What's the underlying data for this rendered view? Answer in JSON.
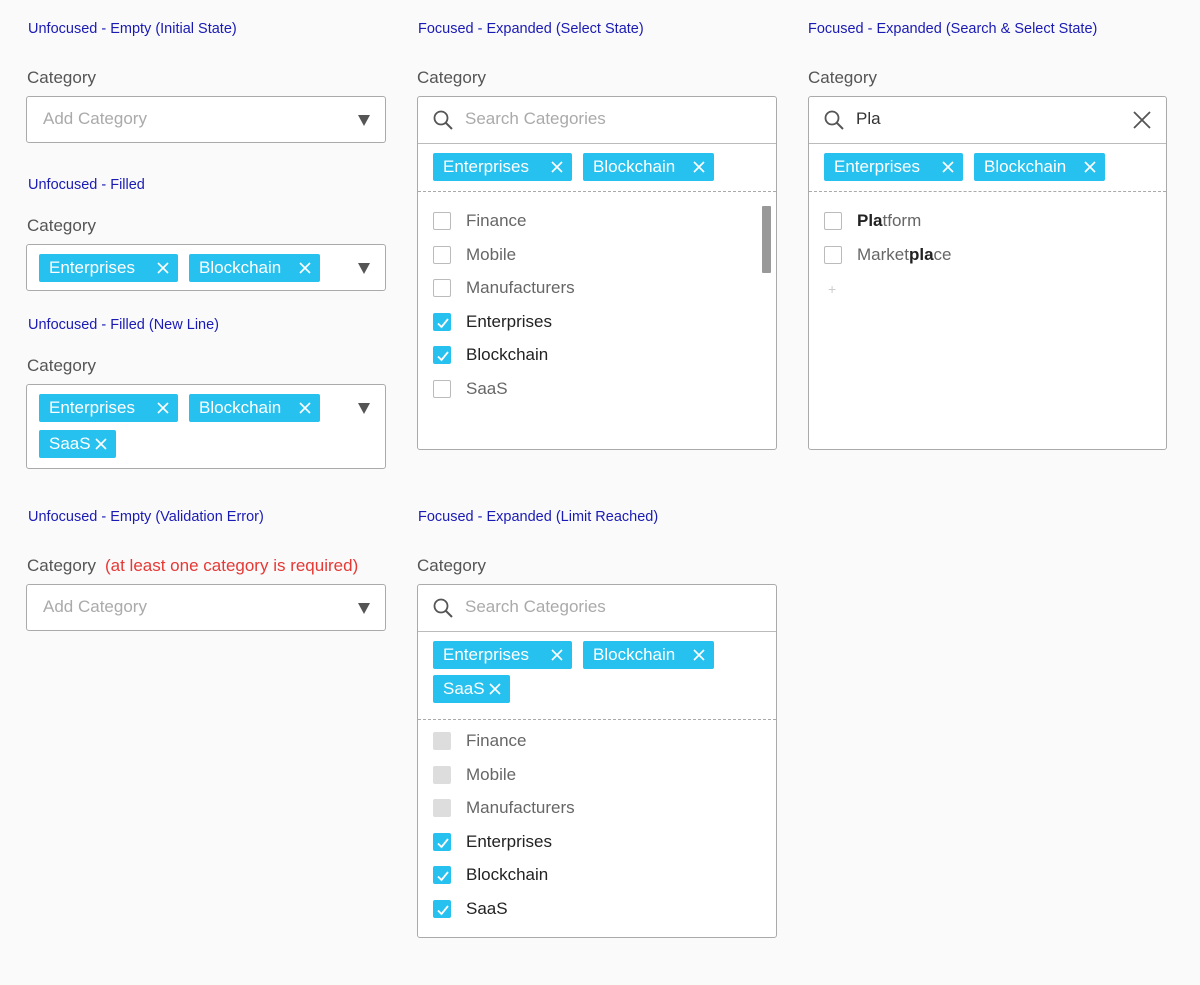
{
  "field_label": "Category",
  "placeholder": "Add Category",
  "search_placeholder": "Search Categories",
  "error_text": "(at least one category is required)",
  "headings": {
    "initial": "Unfocused - Empty (Initial State)",
    "filled": "Unfocused - Filled",
    "newline": "Unfocused - Filled (New Line)",
    "validation": "Unfocused - Empty (Validation Error)",
    "select": "Focused - Expanded (Select State)",
    "limit": "Focused - Expanded (Limit Reached)",
    "search": "Focused - Expanded (Search & Select State)"
  },
  "chips": {
    "enterprises": "Enterprises",
    "blockchain": "Blockchain",
    "saas": "SaaS"
  },
  "options": [
    "Finance",
    "Mobile",
    "Manufacturers",
    "Enterprises",
    "Blockchain",
    "SaaS"
  ],
  "search": {
    "value": "Pla",
    "results": [
      {
        "match": "Pla",
        "rest": "tform"
      },
      {
        "pre": "Market",
        "match": "pla",
        "rest": "ce"
      }
    ],
    "extra": "+"
  },
  "colors": {
    "accent": "#26c1ef",
    "heading": "#1a1ab5",
    "error": "#e53935"
  }
}
